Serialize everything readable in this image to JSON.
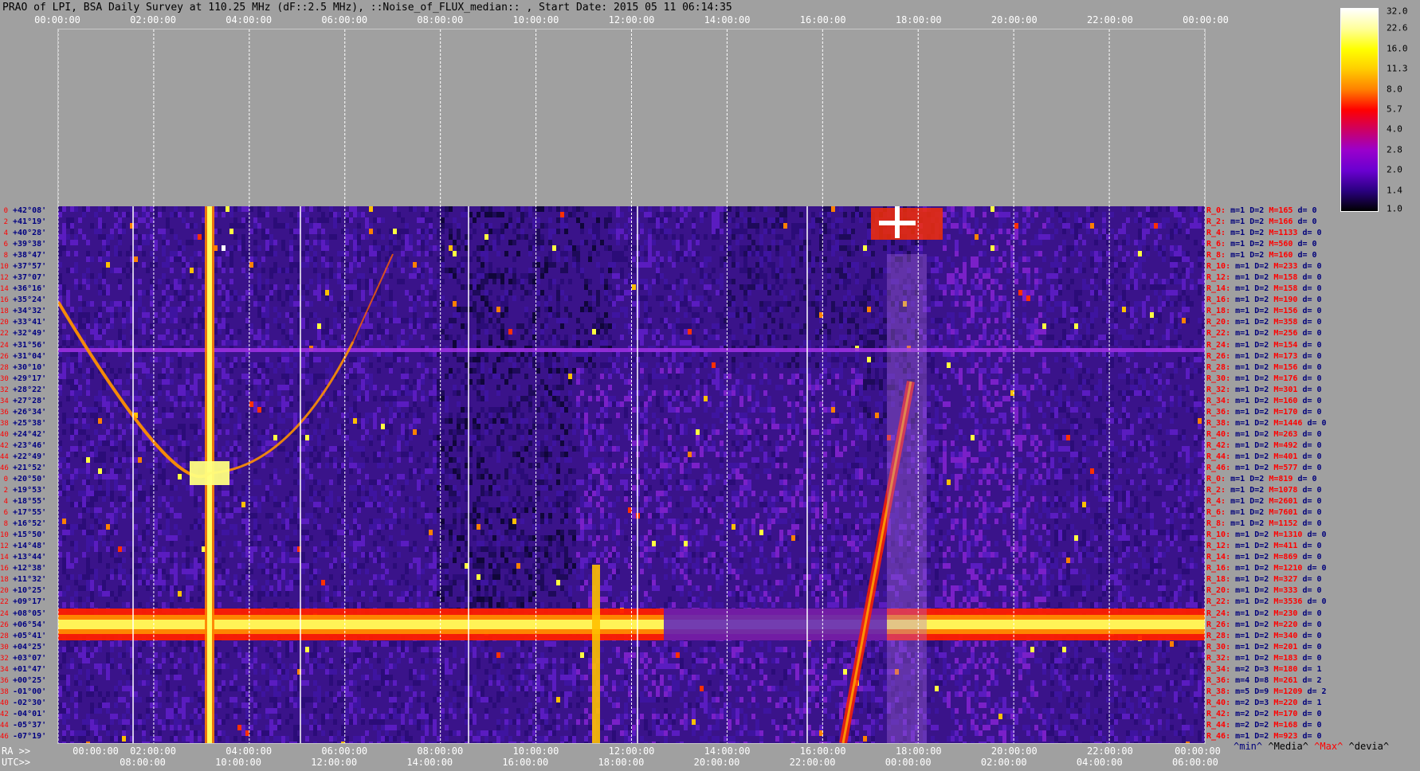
{
  "title": "PRAO of LPI, BSA Daily Survey at 110.25 MHz (dF::2.5 MHz), ::Noise_of_FLUX_median:: , Start Date: 2015 05 11 06:14:35",
  "ra_top_ticks": [
    "00:00:00",
    "02:00:00",
    "04:00:00",
    "06:00:00",
    "08:00:00",
    "10:00:00",
    "12:00:00",
    "14:00:00",
    "16:00:00",
    "18:00:00",
    "20:00:00",
    "22:00:00",
    "00:00:00"
  ],
  "ra_bottom_prefix": "RA >>",
  "ra_bottom_ticks": [
    "00:00:00",
    "02:00:00",
    "04:00:00",
    "06:00:00",
    "08:00:00",
    "10:00:00",
    "12:00:00",
    "14:00:00",
    "16:00:00",
    "18:00:00",
    "20:00:00",
    "22:00:00",
    "00:00:00"
  ],
  "utc_prefix": "UTC>>",
  "utc_ticks": [
    "08:00:00",
    "10:00:00",
    "12:00:00",
    "14:00:00",
    "16:00:00",
    "18:00:00",
    "20:00:00",
    "22:00:00",
    "00:00:00",
    "02:00:00",
    "04:00:00",
    "06:00:00"
  ],
  "legend": {
    "min": "^min^",
    "median": "^Media^",
    "max": "^Max^",
    "devia": "^devia^"
  },
  "colorbar": {
    "ticks": [
      "32.0",
      "22.6",
      "16.0",
      "11.3",
      "8.0",
      "5.7",
      "4.0",
      "2.8",
      "2.0",
      "1.4",
      "1.0"
    ],
    "colors": [
      "#ffffff",
      "#ffff99",
      "#ffff00",
      "#ffcc00",
      "#ff8000",
      "#ff0000",
      "#cc0066",
      "#9900cc",
      "#6a00d0",
      "#2a0080",
      "#000000"
    ]
  },
  "declinations": [
    {
      "idx": "0",
      "dec": "+42°08'"
    },
    {
      "idx": "2",
      "dec": "+41°19'"
    },
    {
      "idx": "4",
      "dec": "+40°28'"
    },
    {
      "idx": "6",
      "dec": "+39°38'"
    },
    {
      "idx": "8",
      "dec": "+38°47'"
    },
    {
      "idx": "10",
      "dec": "+37°57'"
    },
    {
      "idx": "12",
      "dec": "+37°07'"
    },
    {
      "idx": "14",
      "dec": "+36°16'"
    },
    {
      "idx": "16",
      "dec": "+35°24'"
    },
    {
      "idx": "18",
      "dec": "+34°32'"
    },
    {
      "idx": "20",
      "dec": "+33°41'"
    },
    {
      "idx": "22",
      "dec": "+32°49'"
    },
    {
      "idx": "24",
      "dec": "+31°56'"
    },
    {
      "idx": "26",
      "dec": "+31°04'"
    },
    {
      "idx": "28",
      "dec": "+30°10'"
    },
    {
      "idx": "30",
      "dec": "+29°17'"
    },
    {
      "idx": "32",
      "dec": "+28°22'"
    },
    {
      "idx": "34",
      "dec": "+27°28'"
    },
    {
      "idx": "36",
      "dec": "+26°34'"
    },
    {
      "idx": "38",
      "dec": "+25°38'"
    },
    {
      "idx": "40",
      "dec": "+24°42'"
    },
    {
      "idx": "42",
      "dec": "+23°46'"
    },
    {
      "idx": "44",
      "dec": "+22°49'"
    },
    {
      "idx": "46",
      "dec": "+21°52'"
    },
    {
      "idx": "0",
      "dec": "+20°50'"
    },
    {
      "idx": "2",
      "dec": "+19°53'"
    },
    {
      "idx": "4",
      "dec": "+18°55'"
    },
    {
      "idx": "6",
      "dec": "+17°55'"
    },
    {
      "idx": "8",
      "dec": "+16°52'"
    },
    {
      "idx": "10",
      "dec": "+15°50'"
    },
    {
      "idx": "12",
      "dec": "+14°48'"
    },
    {
      "idx": "14",
      "dec": "+13°44'"
    },
    {
      "idx": "16",
      "dec": "+12°38'"
    },
    {
      "idx": "18",
      "dec": "+11°32'"
    },
    {
      "idx": "20",
      "dec": "+10°25'"
    },
    {
      "idx": "22",
      "dec": "+09°17'"
    },
    {
      "idx": "24",
      "dec": "+08°05'"
    },
    {
      "idx": "26",
      "dec": "+06°54'"
    },
    {
      "idx": "28",
      "dec": "+05°41'"
    },
    {
      "idx": "30",
      "dec": "+04°25'"
    },
    {
      "idx": "32",
      "dec": "+03°07'"
    },
    {
      "idx": "34",
      "dec": "+01°47'"
    },
    {
      "idx": "36",
      "dec": "+00°25'"
    },
    {
      "idx": "38",
      "dec": "-01°00'"
    },
    {
      "idx": "40",
      "dec": "-02°30'"
    },
    {
      "idx": "42",
      "dec": "-04°01'"
    },
    {
      "idx": "44",
      "dec": "-05°37'"
    },
    {
      "idx": "46",
      "dec": "-07°19'"
    }
  ],
  "row_stats": [
    {
      "r": "R_0:",
      "m": "m=1",
      "D": "D=2",
      "M": "M=165",
      "d": "d= 0"
    },
    {
      "r": "R_2:",
      "m": "m=1",
      "D": "D=2",
      "M": "M=166",
      "d": "d= 0"
    },
    {
      "r": "R_4:",
      "m": "m=1",
      "D": "D=2",
      "M": "M=1133",
      "d": "d= 0"
    },
    {
      "r": "R_6:",
      "m": "m=1",
      "D": "D=2",
      "M": "M=560",
      "d": "d= 0"
    },
    {
      "r": "R_8:",
      "m": "m=1",
      "D": "D=2",
      "M": "M=160",
      "d": "d= 0"
    },
    {
      "r": "R_10:",
      "m": "m=1",
      "D": "D=2",
      "M": "M=233",
      "d": "d= 0"
    },
    {
      "r": "R_12:",
      "m": "m=1",
      "D": "D=2",
      "M": "M=158",
      "d": "d= 0"
    },
    {
      "r": "R_14:",
      "m": "m=1",
      "D": "D=2",
      "M": "M=158",
      "d": "d= 0"
    },
    {
      "r": "R_16:",
      "m": "m=1",
      "D": "D=2",
      "M": "M=190",
      "d": "d= 0"
    },
    {
      "r": "R_18:",
      "m": "m=1",
      "D": "D=2",
      "M": "M=156",
      "d": "d= 0"
    },
    {
      "r": "R_20:",
      "m": "m=1",
      "D": "D=2",
      "M": "M=358",
      "d": "d= 0"
    },
    {
      "r": "R_22:",
      "m": "m=1",
      "D": "D=2",
      "M": "M=256",
      "d": "d= 0"
    },
    {
      "r": "R_24:",
      "m": "m=1",
      "D": "D=2",
      "M": "M=154",
      "d": "d= 0"
    },
    {
      "r": "R_26:",
      "m": "m=1",
      "D": "D=2",
      "M": "M=173",
      "d": "d= 0"
    },
    {
      "r": "R_28:",
      "m": "m=1",
      "D": "D=2",
      "M": "M=156",
      "d": "d= 0"
    },
    {
      "r": "R_30:",
      "m": "m=1",
      "D": "D=2",
      "M": "M=176",
      "d": "d= 0"
    },
    {
      "r": "R_32:",
      "m": "m=1",
      "D": "D=2",
      "M": "M=301",
      "d": "d= 0"
    },
    {
      "r": "R_34:",
      "m": "m=1",
      "D": "D=2",
      "M": "M=160",
      "d": "d= 0"
    },
    {
      "r": "R_36:",
      "m": "m=1",
      "D": "D=2",
      "M": "M=170",
      "d": "d= 0"
    },
    {
      "r": "R_38:",
      "m": "m=1",
      "D": "D=2",
      "M": "M=1446",
      "d": "d= 0"
    },
    {
      "r": "R_40:",
      "m": "m=1",
      "D": "D=2",
      "M": "M=263",
      "d": "d= 0"
    },
    {
      "r": "R_42:",
      "m": "m=1",
      "D": "D=2",
      "M": "M=492",
      "d": "d= 0"
    },
    {
      "r": "R_44:",
      "m": "m=1",
      "D": "D=2",
      "M": "M=401",
      "d": "d= 0"
    },
    {
      "r": "R_46:",
      "m": "m=1",
      "D": "D=2",
      "M": "M=577",
      "d": "d= 0"
    },
    {
      "r": "R_0:",
      "m": "m=1",
      "D": "D=2",
      "M": "M=819",
      "d": "d= 0"
    },
    {
      "r": "R_2:",
      "m": "m=1",
      "D": "D=2",
      "M": "M=1078",
      "d": "d= 0"
    },
    {
      "r": "R_4:",
      "m": "m=1",
      "D": "D=2",
      "M": "M=2601",
      "d": "d= 0"
    },
    {
      "r": "R_6:",
      "m": "m=1",
      "D": "D=2",
      "M": "M=7601",
      "d": "d= 0"
    },
    {
      "r": "R_8:",
      "m": "m=1",
      "D": "D=2",
      "M": "M=1152",
      "d": "d= 0"
    },
    {
      "r": "R_10:",
      "m": "m=1",
      "D": "D=2",
      "M": "M=1310",
      "d": "d= 0"
    },
    {
      "r": "R_12:",
      "m": "m=1",
      "D": "D=2",
      "M": "M=411",
      "d": "d= 0"
    },
    {
      "r": "R_14:",
      "m": "m=1",
      "D": "D=2",
      "M": "M=869",
      "d": "d= 0"
    },
    {
      "r": "R_16:",
      "m": "m=1",
      "D": "D=2",
      "M": "M=1210",
      "d": "d= 0"
    },
    {
      "r": "R_18:",
      "m": "m=1",
      "D": "D=2",
      "M": "M=327",
      "d": "d= 0"
    },
    {
      "r": "R_20:",
      "m": "m=1",
      "D": "D=2",
      "M": "M=333",
      "d": "d= 0"
    },
    {
      "r": "R_22:",
      "m": "m=1",
      "D": "D=2",
      "M": "M=3536",
      "d": "d= 0"
    },
    {
      "r": "R_24:",
      "m": "m=1",
      "D": "D=2",
      "M": "M=230",
      "d": "d= 0"
    },
    {
      "r": "R_26:",
      "m": "m=1",
      "D": "D=2",
      "M": "M=220",
      "d": "d= 0"
    },
    {
      "r": "R_28:",
      "m": "m=1",
      "D": "D=2",
      "M": "M=340",
      "d": "d= 0"
    },
    {
      "r": "R_30:",
      "m": "m=1",
      "D": "D=2",
      "M": "M=201",
      "d": "d= 0"
    },
    {
      "r": "R_32:",
      "m": "m=1",
      "D": "D=2",
      "M": "M=183",
      "d": "d= 0"
    },
    {
      "r": "R_34:",
      "m": "m=2",
      "D": "D=3",
      "M": "M=180",
      "d": "d= 1"
    },
    {
      "r": "R_36:",
      "m": "m=4",
      "D": "D=8",
      "M": "M=261",
      "d": "d= 2"
    },
    {
      "r": "R_38:",
      "m": "m=5",
      "D": "D=9",
      "M": "M=1209",
      "d": "d= 2"
    },
    {
      "r": "R_40:",
      "m": "m=2",
      "D": "D=3",
      "M": "M=220",
      "d": "d= 1"
    },
    {
      "r": "R_42:",
      "m": "m=2",
      "D": "D=2",
      "M": "M=170",
      "d": "d= 0"
    },
    {
      "r": "R_44:",
      "m": "m=2",
      "D": "D=2",
      "M": "M=168",
      "d": "d= 0"
    },
    {
      "r": "R_46:",
      "m": "m=1",
      "D": "D=2",
      "M": "M=923",
      "d": "d= 0"
    }
  ],
  "chart_data": {
    "type": "heatmap",
    "title": "PRAO of LPI, BSA Daily Survey at 110.25 MHz (dF::2.5 MHz), ::Noise_of_FLUX_median:: , Start Date: 2015 05 11 06:14:35",
    "x_axis_top": "RA 00:00:00 to 00:00:00",
    "x_axis_bottom_utc": "08:00:00 to 06:00:00",
    "y_axis": "Declination +42°08' to -07°19' (48 beams)",
    "color_scale": [
      1.0,
      32.0
    ],
    "color_scale_type": "log"
  }
}
